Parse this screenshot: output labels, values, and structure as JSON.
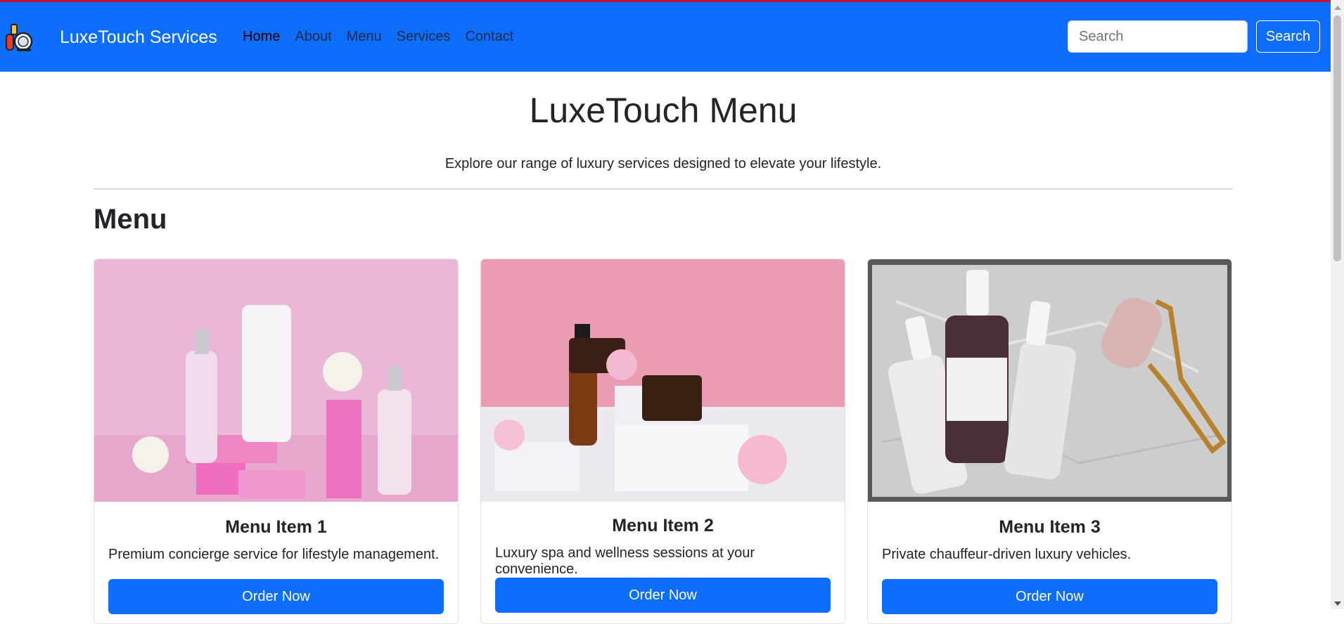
{
  "colors": {
    "navbar": "#0d6efd",
    "accent_line": "#c8102e",
    "button": "#0d6efd"
  },
  "navbar": {
    "logo_icon": "cosmetics-logo-icon",
    "brand": "LuxeTouch Services",
    "links": [
      "Home",
      "About",
      "Menu",
      "Services",
      "Contact"
    ],
    "active_link": "Home",
    "search": {
      "placeholder": "Search",
      "value": "",
      "button_label": "Search"
    }
  },
  "header": {
    "title": "LuxeTouch Menu",
    "subtitle": "Explore our range of luxury services designed to elevate your lifestyle."
  },
  "menu": {
    "heading": "Menu",
    "items": [
      {
        "title": "Menu Item 1",
        "description": "Premium concierge service for lifestyle management.",
        "button_label": "Order Now",
        "image": "pink-skincare-products-photo"
      },
      {
        "title": "Menu Item 2",
        "description": "Luxury spa and wellness sessions at your convenience.",
        "button_label": "Order Now",
        "image": "serum-jars-and-flowers-photo"
      },
      {
        "title": "Menu Item 3",
        "description": "Private chauffeur-driven luxury vehicles.",
        "button_label": "Order Now",
        "image": "serum-bottles-on-marble-photo"
      }
    ]
  }
}
